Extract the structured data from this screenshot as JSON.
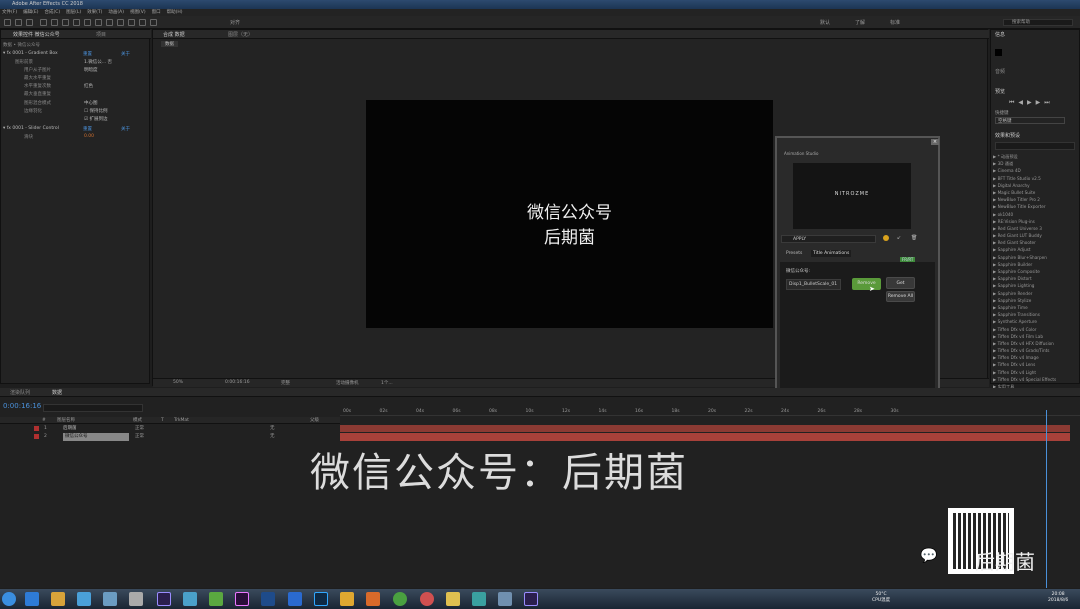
{
  "window": {
    "title": "Adobe After Effects CC 2018"
  },
  "menu": [
    "文件(F)",
    "编辑(E)",
    "合成(C)",
    "图层(L)",
    "效果(T)",
    "动画(A)",
    "视图(V)",
    "窗口",
    "帮助(H)"
  ],
  "toolbar": {
    "workspace_default": "默认",
    "workspace_learn": "了解",
    "workspace_standard": "标准",
    "search_placeholder": "搜索帮助"
  },
  "effect_controls": {
    "tab": "效果控件 微信公众号",
    "tab2": "项目",
    "breadcrumb": "数据 • 微信公众号",
    "effects": [
      {
        "name": "0001 - Gradient Box",
        "reset": "重置",
        "about": "关于"
      },
      {
        "name": "0001 - Slider Control",
        "reset": "重置",
        "about": "关于"
      }
    ],
    "rows": [
      {
        "label": "图形前景",
        "value": "1.微信公... 否"
      },
      {
        "label": "用户从子图片",
        "value": "明暗度"
      },
      {
        "label": "最大水平重复",
        "value": ""
      },
      {
        "label": "水平重复次数",
        "value": "红色"
      },
      {
        "label": "最大垂直重复",
        "value": ""
      },
      {
        "label": "图形混合模式",
        "value": "中心图"
      },
      {
        "label": "边缘羽化",
        "value": "保持比例"
      },
      {
        "label": "",
        "value": "扩展到边"
      },
      {
        "label": "滑块",
        "value": ""
      }
    ]
  },
  "composition": {
    "tab": "合成 数据",
    "tab_label": "数据",
    "layer_tab": "图层（无）",
    "text_line1": "微信公众号",
    "text_line2": "后期菌",
    "zoom": "50%",
    "timecode": "0:00:16:16",
    "quality": "完整",
    "camera": "活动摄像机",
    "views": "1个..."
  },
  "right_panel": {
    "info_tab": "信息",
    "audio_tab": "音频",
    "preview_tab": "预览",
    "preview_label": "快捷键",
    "preview_shortcut": "空格键",
    "effects_tab": "效果和预设",
    "search_value": "",
    "effects": [
      "* 动画预设",
      "3D 通道",
      "Cinema 4D",
      "BFT Title Studio v2.5",
      "Digital Anarchy",
      "Magic Bullet Suite",
      "NewBlue Titler Pro 2",
      "NewBlue Title Exporter",
      "ok1040",
      "RE:Vision Plug-ins",
      "Red Giant Universe 3",
      "Red Giant LUT Buddy",
      "Red Giant Shooter",
      "Sapphire Adjust",
      "Sapphire Blur+Sharpen",
      "Sapphire Builder",
      "Sapphire Composite",
      "Sapphire Distort",
      "Sapphire Lighting",
      "Sapphire Render",
      "Sapphire Stylize",
      "Sapphire Time",
      "Sapphire Transitions",
      "Synthetic Aperture",
      "Tiffen Dfx v4 Color",
      "Tiffen Dfx v4 Film Lab",
      "Tiffen Dfx v4 HFX Diffusion",
      "Tiffen Dfx v4 Grads/Tints",
      "Tiffen Dfx v4 Image",
      "Tiffen Dfx v4 Lens",
      "Tiffen Dfx v4 Light",
      "Tiffen Dfx v4 Special Effects",
      "实用工具"
    ]
  },
  "extension": {
    "title": "Animation Studio",
    "logo": "NITROZME",
    "apply": "APPLY",
    "tab_presets": "Presets",
    "tab_title": "Title Animations",
    "badge": "FR/RT",
    "layer_label": "微信公众号:",
    "preset_value": "Disp1_BulletScale_01",
    "remove": "Remove",
    "get": "Get",
    "remove_all": "Remove All"
  },
  "timeline": {
    "tab1": "渲染队列",
    "tab2": "数据",
    "timecode": "0:00:16:16",
    "search_placeholder": "",
    "columns": [
      "#",
      "图层名称",
      "模式",
      "T",
      "TrkMat",
      "父级"
    ],
    "layers": [
      {
        "num": "1",
        "name": "后期菌",
        "mode": "正常",
        "parent": "无"
      },
      {
        "num": "2",
        "name": "微信公众号",
        "mode": "正常",
        "parent": "无"
      }
    ],
    "ruler": [
      "00s",
      "02s",
      "04s",
      "06s",
      "08s",
      "10s",
      "12s",
      "14s",
      "16s",
      "18s",
      "20s",
      "22s",
      "24s",
      "26s",
      "28s",
      "30s"
    ]
  },
  "watermark": {
    "text": "微信公众号：后期菌"
  },
  "qr_brand": "后期菌",
  "taskbar": {
    "clock_time": "20:08",
    "clock_date": "2018/8/6",
    "cpu": "50°C",
    "cpu_label": "CPU温度"
  }
}
